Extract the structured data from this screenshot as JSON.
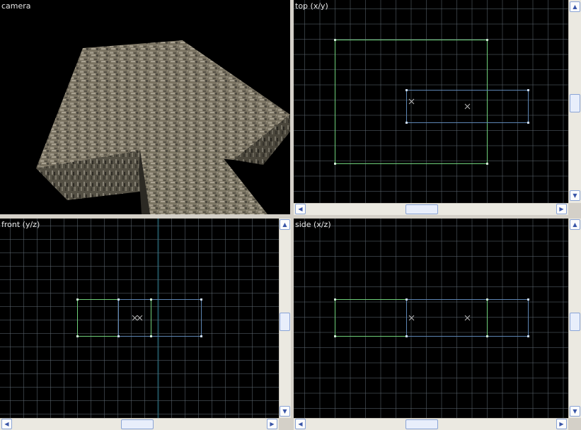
{
  "viewports": {
    "camera": {
      "label": "camera"
    },
    "top": {
      "label": "top (x/y)"
    },
    "front": {
      "label": "front (y/z)"
    },
    "side": {
      "label": "side (x/z)"
    }
  },
  "scrollbar": {
    "up_icon": "arrow-up-icon",
    "down_icon": "arrow-down-icon",
    "left_icon": "arrow-left-icon",
    "right_icon": "arrow-right-icon"
  },
  "colors": {
    "background": "#000000",
    "grid_minor": "#5c6670",
    "grid_major": "#1f4f5c",
    "brush_selected": "#6fd07a",
    "brush_secondary": "#5d86b4",
    "origin_mark": "#9a9a9a",
    "stone_texture": "#6b6656"
  }
}
